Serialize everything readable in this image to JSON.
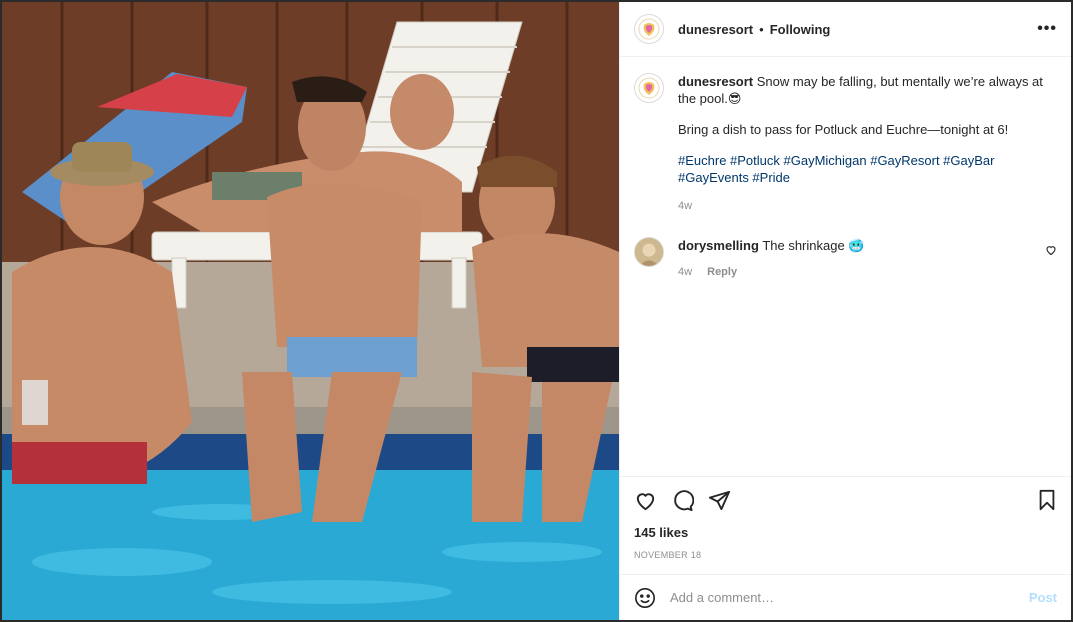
{
  "post": {
    "username": "dunesresort",
    "separator": "•",
    "following_label": "Following",
    "more_label": "•••",
    "caption": {
      "text": "Snow may be falling, but mentally we’re always at the pool.😎",
      "line2": "Bring a dish to pass for Potluck and Euchre—tonight at 6!",
      "hashtags": "#Euchre #Potluck #GayMichigan #GayResort #GayBar #GayEvents #Pride",
      "age": "4w"
    },
    "comments": [
      {
        "username": "dorysmelling",
        "text": "The shrinkage 🥶",
        "age": "4w",
        "reply_label": "Reply"
      }
    ],
    "likes": "145 likes",
    "date": "NOVEMBER 18",
    "add_comment_placeholder": "Add a comment…",
    "post_button": "Post"
  },
  "icons": {
    "more": "more-options-icon",
    "heart": "heart-icon",
    "comment": "comment-icon",
    "share": "share-icon",
    "bookmark": "bookmark-icon",
    "emoji": "emoji-icon"
  },
  "colors": {
    "hashtag": "#00376b",
    "post_button": "#b2dffc",
    "muted": "#8e8e8e",
    "pool": "#29a9d4"
  }
}
